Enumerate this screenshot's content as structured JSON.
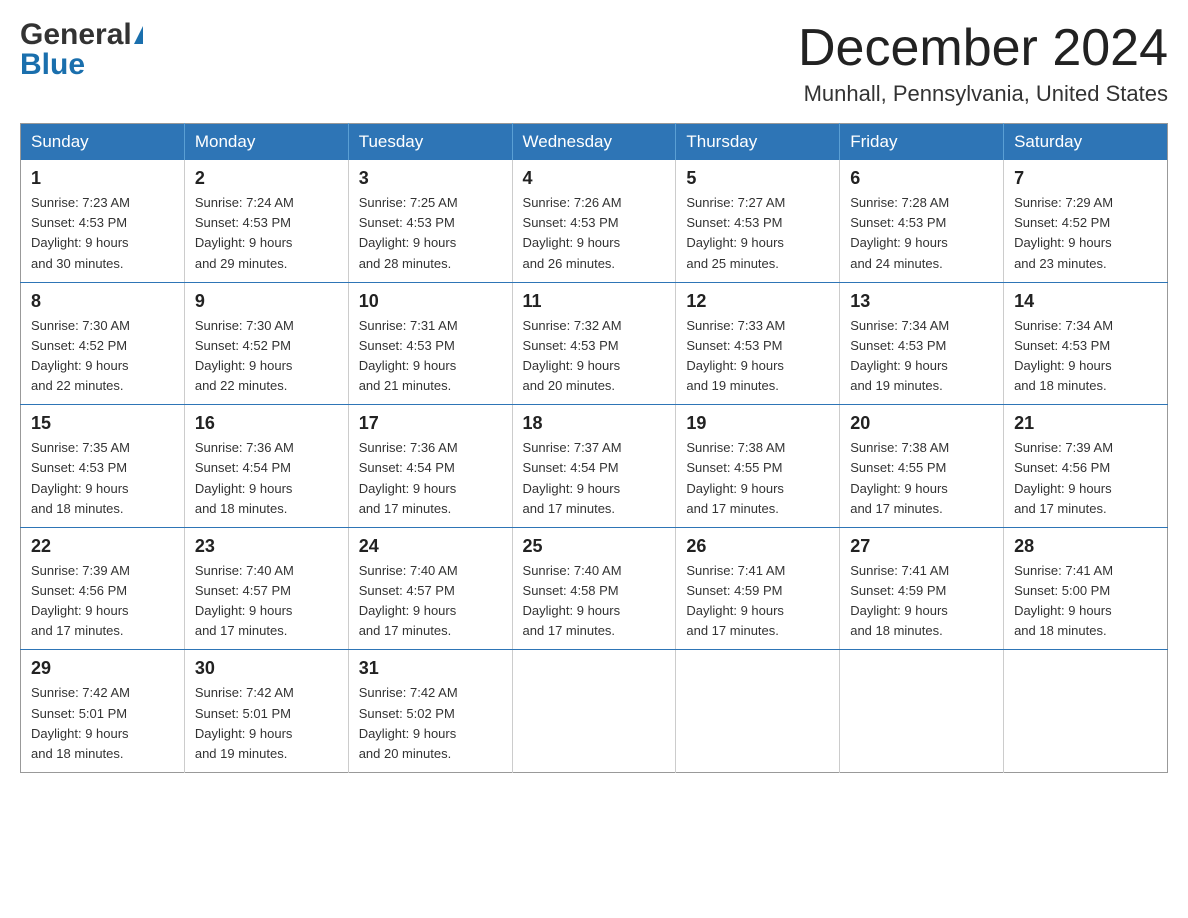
{
  "header": {
    "logo_line1": "General",
    "logo_line2": "Blue",
    "month_title": "December 2024",
    "location": "Munhall, Pennsylvania, United States"
  },
  "days_of_week": [
    "Sunday",
    "Monday",
    "Tuesday",
    "Wednesday",
    "Thursday",
    "Friday",
    "Saturday"
  ],
  "weeks": [
    [
      {
        "day": "1",
        "sunrise": "7:23 AM",
        "sunset": "4:53 PM",
        "daylight": "9 hours and 30 minutes."
      },
      {
        "day": "2",
        "sunrise": "7:24 AM",
        "sunset": "4:53 PM",
        "daylight": "9 hours and 29 minutes."
      },
      {
        "day": "3",
        "sunrise": "7:25 AM",
        "sunset": "4:53 PM",
        "daylight": "9 hours and 28 minutes."
      },
      {
        "day": "4",
        "sunrise": "7:26 AM",
        "sunset": "4:53 PM",
        "daylight": "9 hours and 26 minutes."
      },
      {
        "day": "5",
        "sunrise": "7:27 AM",
        "sunset": "4:53 PM",
        "daylight": "9 hours and 25 minutes."
      },
      {
        "day": "6",
        "sunrise": "7:28 AM",
        "sunset": "4:53 PM",
        "daylight": "9 hours and 24 minutes."
      },
      {
        "day": "7",
        "sunrise": "7:29 AM",
        "sunset": "4:52 PM",
        "daylight": "9 hours and 23 minutes."
      }
    ],
    [
      {
        "day": "8",
        "sunrise": "7:30 AM",
        "sunset": "4:52 PM",
        "daylight": "9 hours and 22 minutes."
      },
      {
        "day": "9",
        "sunrise": "7:30 AM",
        "sunset": "4:52 PM",
        "daylight": "9 hours and 22 minutes."
      },
      {
        "day": "10",
        "sunrise": "7:31 AM",
        "sunset": "4:53 PM",
        "daylight": "9 hours and 21 minutes."
      },
      {
        "day": "11",
        "sunrise": "7:32 AM",
        "sunset": "4:53 PM",
        "daylight": "9 hours and 20 minutes."
      },
      {
        "day": "12",
        "sunrise": "7:33 AM",
        "sunset": "4:53 PM",
        "daylight": "9 hours and 19 minutes."
      },
      {
        "day": "13",
        "sunrise": "7:34 AM",
        "sunset": "4:53 PM",
        "daylight": "9 hours and 19 minutes."
      },
      {
        "day": "14",
        "sunrise": "7:34 AM",
        "sunset": "4:53 PM",
        "daylight": "9 hours and 18 minutes."
      }
    ],
    [
      {
        "day": "15",
        "sunrise": "7:35 AM",
        "sunset": "4:53 PM",
        "daylight": "9 hours and 18 minutes."
      },
      {
        "day": "16",
        "sunrise": "7:36 AM",
        "sunset": "4:54 PM",
        "daylight": "9 hours and 18 minutes."
      },
      {
        "day": "17",
        "sunrise": "7:36 AM",
        "sunset": "4:54 PM",
        "daylight": "9 hours and 17 minutes."
      },
      {
        "day": "18",
        "sunrise": "7:37 AM",
        "sunset": "4:54 PM",
        "daylight": "9 hours and 17 minutes."
      },
      {
        "day": "19",
        "sunrise": "7:38 AM",
        "sunset": "4:55 PM",
        "daylight": "9 hours and 17 minutes."
      },
      {
        "day": "20",
        "sunrise": "7:38 AM",
        "sunset": "4:55 PM",
        "daylight": "9 hours and 17 minutes."
      },
      {
        "day": "21",
        "sunrise": "7:39 AM",
        "sunset": "4:56 PM",
        "daylight": "9 hours and 17 minutes."
      }
    ],
    [
      {
        "day": "22",
        "sunrise": "7:39 AM",
        "sunset": "4:56 PM",
        "daylight": "9 hours and 17 minutes."
      },
      {
        "day": "23",
        "sunrise": "7:40 AM",
        "sunset": "4:57 PM",
        "daylight": "9 hours and 17 minutes."
      },
      {
        "day": "24",
        "sunrise": "7:40 AM",
        "sunset": "4:57 PM",
        "daylight": "9 hours and 17 minutes."
      },
      {
        "day": "25",
        "sunrise": "7:40 AM",
        "sunset": "4:58 PM",
        "daylight": "9 hours and 17 minutes."
      },
      {
        "day": "26",
        "sunrise": "7:41 AM",
        "sunset": "4:59 PM",
        "daylight": "9 hours and 17 minutes."
      },
      {
        "day": "27",
        "sunrise": "7:41 AM",
        "sunset": "4:59 PM",
        "daylight": "9 hours and 18 minutes."
      },
      {
        "day": "28",
        "sunrise": "7:41 AM",
        "sunset": "5:00 PM",
        "daylight": "9 hours and 18 minutes."
      }
    ],
    [
      {
        "day": "29",
        "sunrise": "7:42 AM",
        "sunset": "5:01 PM",
        "daylight": "9 hours and 18 minutes."
      },
      {
        "day": "30",
        "sunrise": "7:42 AM",
        "sunset": "5:01 PM",
        "daylight": "9 hours and 19 minutes."
      },
      {
        "day": "31",
        "sunrise": "7:42 AM",
        "sunset": "5:02 PM",
        "daylight": "9 hours and 20 minutes."
      },
      null,
      null,
      null,
      null
    ]
  ],
  "labels": {
    "sunrise": "Sunrise:",
    "sunset": "Sunset:",
    "daylight": "Daylight:"
  }
}
